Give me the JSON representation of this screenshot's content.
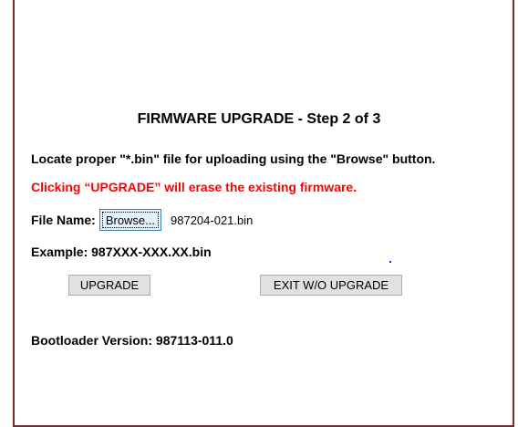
{
  "page": {
    "title": "FIRMWARE UPGRADE - Step 2 of 3",
    "instruction": "Locate proper \"*.bin\" file for uploading using the \"Browse\" button.",
    "warning": "Clicking “UPGRADE” will erase the existing firmware.",
    "file_label": "File Name:",
    "browse_label": "Browse...",
    "file_name": "987204-021.bin",
    "example": "Example: 987XXX-XXX.XX.bin",
    "upgrade_label": "UPGRADE",
    "exit_label": "EXIT W/O UPGRADE",
    "bootloader": "Bootloader Version: 987113-011.0"
  },
  "colors": {
    "border": "#7a2a2a",
    "warning": "#ff0000"
  }
}
